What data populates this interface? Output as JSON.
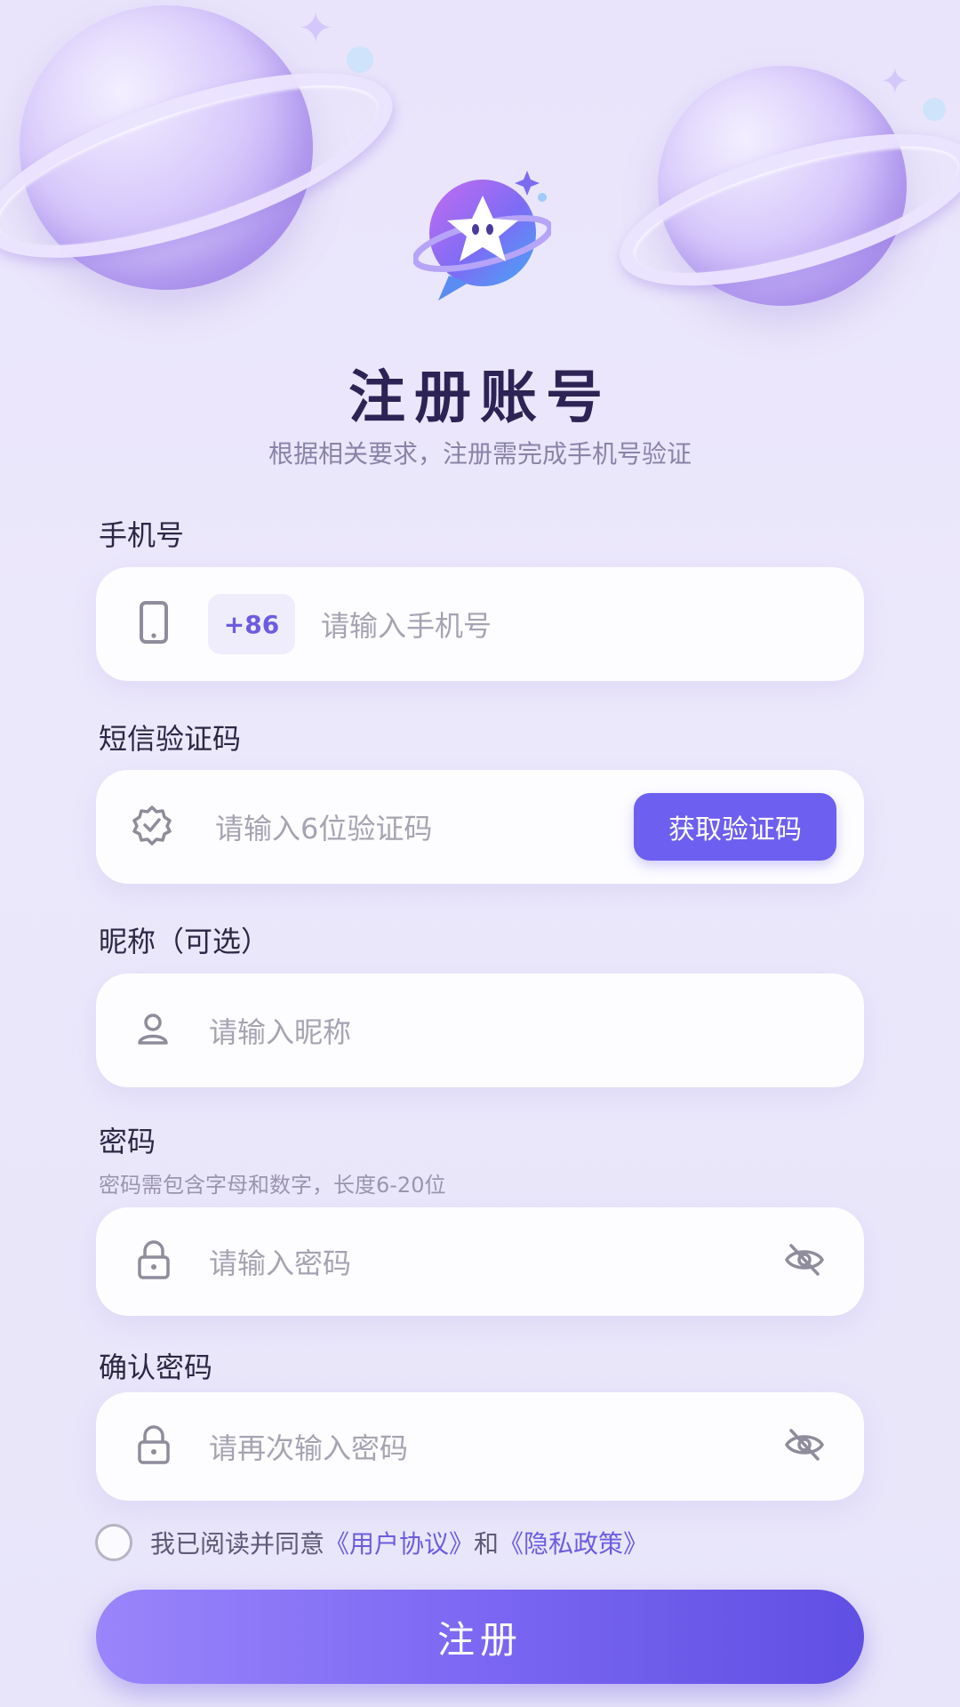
{
  "header": {
    "title": "注册账号",
    "subtitle": "根据相关要求，注册需完成手机号验证"
  },
  "phone": {
    "label": "手机号",
    "country_code": "+86",
    "placeholder": "请输入手机号",
    "icon": "phone-icon"
  },
  "sms": {
    "label": "短信验证码",
    "placeholder": "请输入6位验证码",
    "button": "获取验证码",
    "icon": "verified-badge-icon"
  },
  "nickname": {
    "label": "昵称（可选）",
    "placeholder": "请输入昵称",
    "icon": "user-icon"
  },
  "password": {
    "label": "密码",
    "hint": "密码需包含字母和数字，长度6-20位",
    "placeholder": "请输入密码",
    "icon": "lock-icon",
    "toggle_icon": "eye-off-icon"
  },
  "confirm_password": {
    "label": "确认密码",
    "placeholder": "请再次输入密码",
    "icon": "lock-icon",
    "toggle_icon": "eye-off-icon"
  },
  "agreement": {
    "prefix": "我已阅读并同意",
    "user_agreement": "《用户协议》",
    "and": "和",
    "privacy_policy": "《隐私政策》",
    "checked": false
  },
  "submit": {
    "label": "注册"
  },
  "colors": {
    "accent": "#6d5ff0",
    "title": "#2d2455",
    "placeholder": "#a6a3b3",
    "background": "#ebe7fb"
  }
}
